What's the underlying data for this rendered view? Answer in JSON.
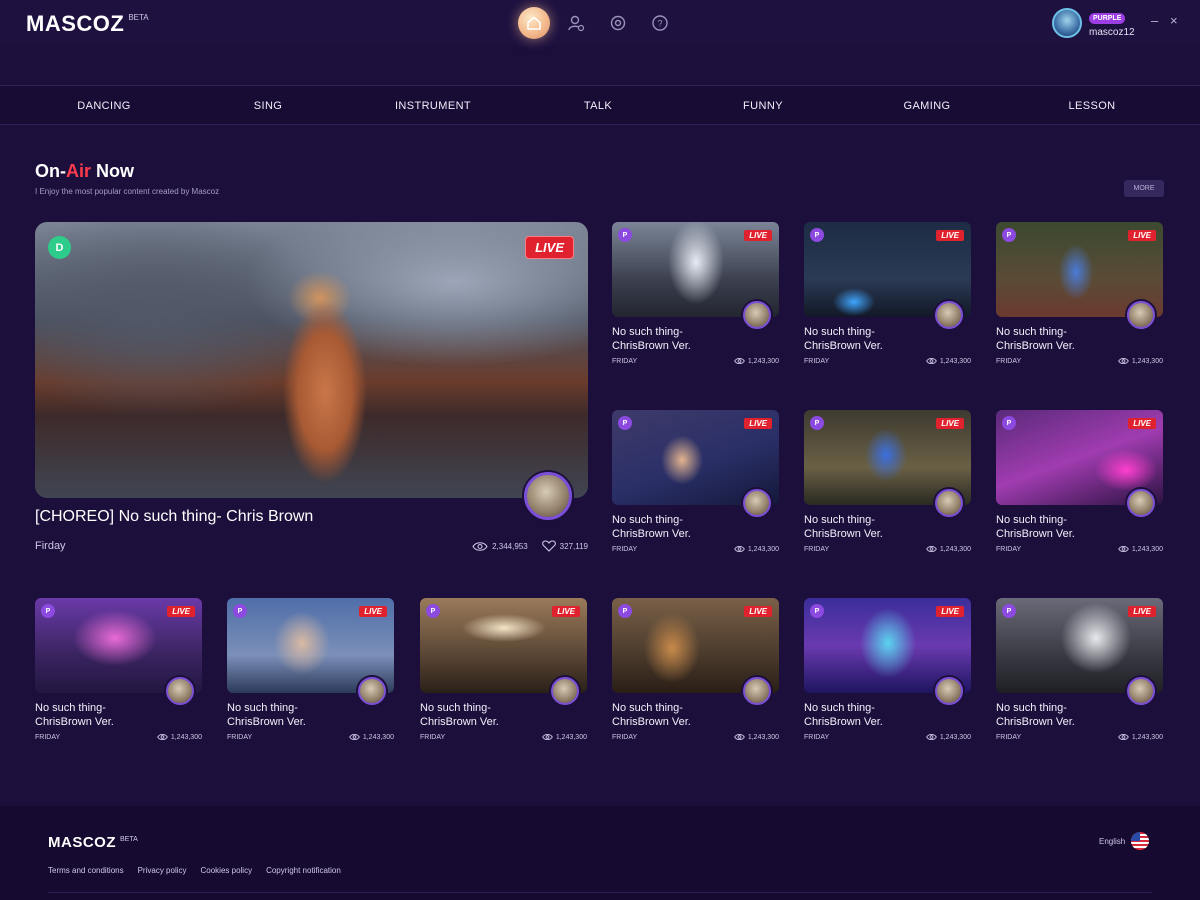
{
  "header": {
    "logo": "MASCOZ",
    "beta": "BETA",
    "nav_icons": [
      "home-icon",
      "user-settings-icon",
      "camera-icon",
      "help-icon"
    ],
    "user": {
      "badge": "PURPLE",
      "username": "mascoz12"
    },
    "window_controls": {
      "minimize": "–",
      "close": "×"
    }
  },
  "categories": [
    "DANCING",
    "SING",
    "INSTRUMENT",
    "TALK",
    "FUNNY",
    "GAMING",
    "LESSON"
  ],
  "section": {
    "title_prefix": "On-",
    "title_accent": "Air",
    "title_suffix": " Now",
    "subtitle": "I Enjoy the most popular content created by Mascoz",
    "more_label": "MORE"
  },
  "featured": {
    "badge": "D",
    "live_label": "LIVE",
    "title": "[CHOREO] No such thing- Chris Brown",
    "day": "Firday",
    "views": "2,344,953",
    "likes": "327,119"
  },
  "cards": [
    {
      "live": "LIVE",
      "badge": "P",
      "title": "No such thing-ChrisBrown Ver.",
      "day": "FRIDAY",
      "views": "1,243,300"
    },
    {
      "live": "LIVE",
      "badge": "P",
      "title": "No such thing-ChrisBrown Ver.",
      "day": "FRIDAY",
      "views": "1,243,300"
    },
    {
      "live": "LIVE",
      "badge": "P",
      "title": "No such thing-ChrisBrown Ver.",
      "day": "FRIDAY",
      "views": "1,243,300"
    },
    {
      "live": "LIVE",
      "badge": "P",
      "title": "No such thing-ChrisBrown Ver.",
      "day": "FRIDAY",
      "views": "1,243,300"
    },
    {
      "live": "LIVE",
      "badge": "P",
      "title": "No such thing-ChrisBrown Ver.",
      "day": "FRIDAY",
      "views": "1,243,300"
    },
    {
      "live": "LIVE",
      "badge": "P",
      "title": "No such thing-ChrisBrown Ver.",
      "day": "FRIDAY",
      "views": "1,243,300"
    },
    {
      "live": "LIVE",
      "badge": "P",
      "title": "No such thing-ChrisBrown Ver.",
      "day": "FRIDAY",
      "views": "1,243,300"
    },
    {
      "live": "LIVE",
      "badge": "P",
      "title": "No such thing-ChrisBrown Ver.",
      "day": "FRIDAY",
      "views": "1,243,300"
    },
    {
      "live": "LIVE",
      "badge": "P",
      "title": "No such thing-ChrisBrown Ver.",
      "day": "FRIDAY",
      "views": "1,243,300"
    },
    {
      "live": "LIVE",
      "badge": "P",
      "title": "No such thing-ChrisBrown Ver.",
      "day": "FRIDAY",
      "views": "1,243,300"
    },
    {
      "live": "LIVE",
      "badge": "P",
      "title": "No such thing-ChrisBrown Ver.",
      "day": "FRIDAY",
      "views": "1,243,300"
    },
    {
      "live": "LIVE",
      "badge": "P",
      "title": "No such thing-ChrisBrown Ver.",
      "day": "FRIDAY",
      "views": "1,243,300"
    }
  ],
  "footer": {
    "logo": "MASCOZ",
    "beta": "BETA",
    "links": [
      "Terms and conditions",
      "Privacy policy",
      "Cookies policy",
      "Copyright notification"
    ],
    "language": "English"
  },
  "colors": {
    "background": "#1c0f3c",
    "accent_red": "#ff3b4d",
    "live_red": "#e0222f",
    "purple": "#8d4ae0"
  }
}
